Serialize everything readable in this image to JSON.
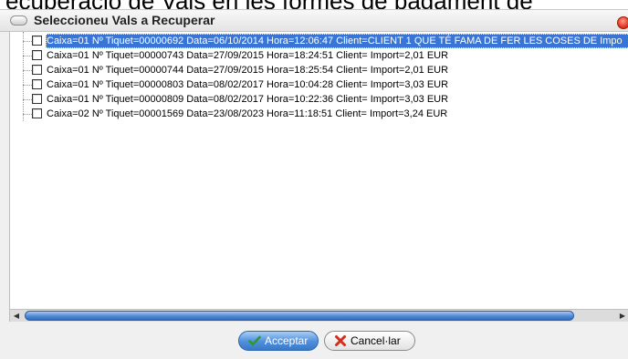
{
  "background": {
    "partial_text": "ecuperació de Vals en les formes de pagament de"
  },
  "dialog": {
    "title": "Seleccioneu Vals a Recuperar",
    "items": [
      {
        "label": "Caixa=01 Nº Tiquet=00000692 Data=06/10/2014 Hora=12:06:47 Client=CLIENT 1 QUE TÉ FAMA DE FER LES COSES DE Impo",
        "checked": false,
        "selected": true
      },
      {
        "label": "Caixa=01 Nº Tiquet=00000743 Data=27/09/2015 Hora=18:24:51 Client= Import=2,01 EUR",
        "checked": false,
        "selected": false
      },
      {
        "label": "Caixa=01 Nº Tiquet=00000744 Data=27/09/2015 Hora=18:25:54 Client= Import=2,01 EUR",
        "checked": false,
        "selected": false
      },
      {
        "label": "Caixa=01 Nº Tiquet=00000803 Data=08/02/2017 Hora=10:04:28 Client= Import=3,03 EUR",
        "checked": false,
        "selected": false
      },
      {
        "label": "Caixa=01 Nº Tiquet=00000809 Data=08/02/2017 Hora=10:22:36 Client= Import=3,03 EUR",
        "checked": false,
        "selected": false
      },
      {
        "label": "Caixa=02 Nº Tiquet=00001569 Data=23/08/2023 Hora=11:18:51 Client= Import=3,24 EUR",
        "checked": false,
        "selected": false
      }
    ],
    "buttons": {
      "accept_label": "Acceptar",
      "cancel_label": "Cancel·lar"
    }
  },
  "colors": {
    "selection": "#3875d7",
    "accept_button": "#4e8fdc",
    "close_button": "#e23a22",
    "cancel_icon": "#d62a1a",
    "accept_icon": "#2e9a2e"
  },
  "icons": {
    "title": "window-pill-icon",
    "close": "close-icon",
    "accept": "check-icon",
    "cancel": "x-icon"
  }
}
